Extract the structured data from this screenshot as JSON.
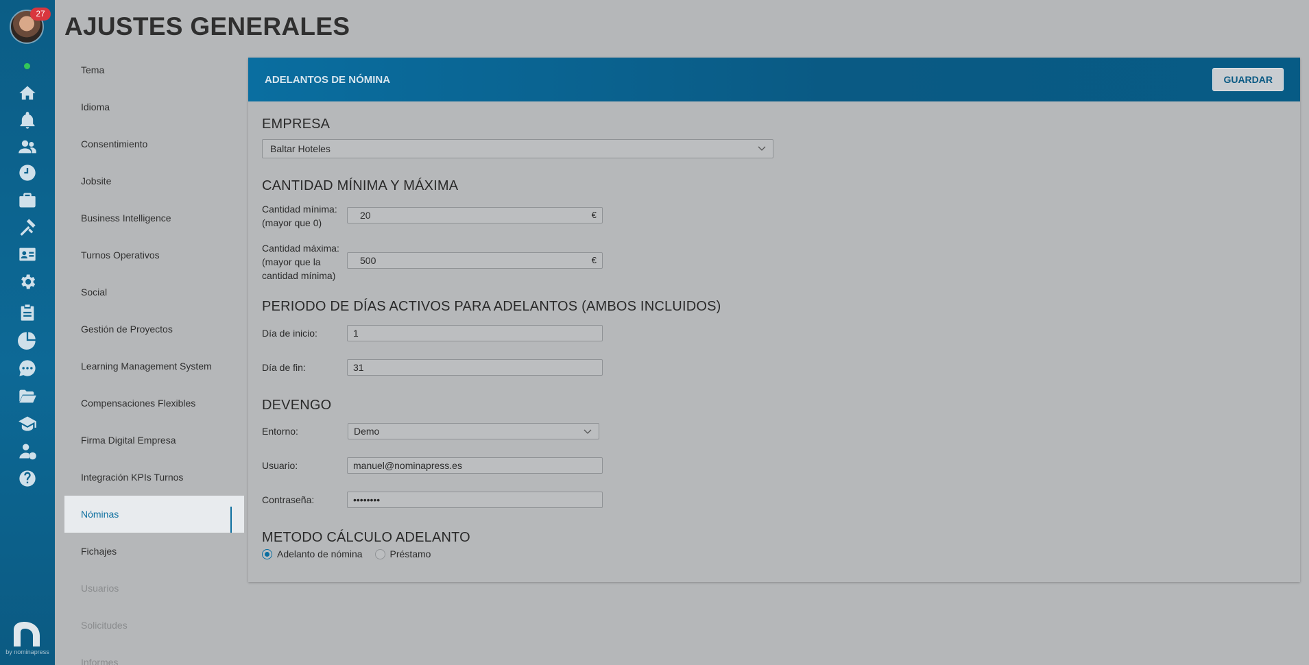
{
  "rail": {
    "notification_count": "27",
    "brand_caption": "by nominapress"
  },
  "page": {
    "title": "AJUSTES GENERALES"
  },
  "settings_nav": [
    {
      "label": "Tema"
    },
    {
      "label": "Idioma"
    },
    {
      "label": "Consentimiento"
    },
    {
      "label": "Jobsite"
    },
    {
      "label": "Business Intelligence"
    },
    {
      "label": "Turnos Operativos"
    },
    {
      "label": "Social"
    },
    {
      "label": "Gestión de Proyectos"
    },
    {
      "label": "Learning Management System"
    },
    {
      "label": "Compensaciones Flexibles"
    },
    {
      "label": "Firma Digital Empresa"
    },
    {
      "label": "Integración KPIs Turnos"
    },
    {
      "label": "Nóminas"
    },
    {
      "label": "Fichajes"
    },
    {
      "label": "Usuarios"
    },
    {
      "label": "Solicitudes"
    },
    {
      "label": "Informes"
    }
  ],
  "panel": {
    "title": "ADELANTOS DE NÓMINA",
    "save_label": "GUARDAR",
    "empresa": {
      "heading": "EMPRESA",
      "selected": "Baltar Hoteles"
    },
    "cantidad": {
      "heading": "CANTIDAD MÍNIMA Y MÁXIMA",
      "min_label_1": "Cantidad mínima:",
      "min_label_2": "(mayor que 0)",
      "min_value": "20",
      "max_label_1": "Cantidad máxima:",
      "max_label_2": "(mayor que la",
      "max_label_3": "cantidad mínima)",
      "max_value": "500",
      "currency": "€"
    },
    "periodo": {
      "heading": "PERIODO DE DÍAS ACTIVOS PARA ADELANTOS (AMBOS INCLUIDOS)",
      "start_label": "Día de inicio:",
      "start_value": "1",
      "end_label": "Día de fin:",
      "end_value": "31"
    },
    "devengo": {
      "heading": "DEVENGO",
      "env_label": "Entorno:",
      "env_value": "Demo",
      "user_label": "Usuario:",
      "user_value": "manuel@nominapress.es",
      "pass_label": "Contraseña:",
      "pass_value": "••••••••"
    },
    "metodo": {
      "heading": "METODO CÁLCULO ADELANTO",
      "option_1": "Adelanto de nómina",
      "option_2": "Préstamo",
      "selected": "Adelanto de nómina"
    }
  },
  "colors": {
    "accent": "#0a6ea0",
    "badge": "#d9363e",
    "online": "#34c759"
  }
}
